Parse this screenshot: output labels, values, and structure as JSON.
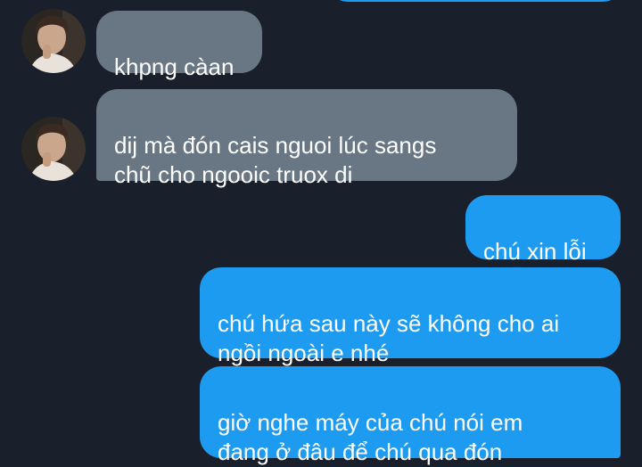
{
  "messages": [
    {
      "sender": "them",
      "text": "khpng càan"
    },
    {
      "sender": "them",
      "text": "dij mà đón cais nguoi lúc sangs\nchũ cho ngooic truox di"
    },
    {
      "sender": "me",
      "text": "chú xin lỗi"
    },
    {
      "sender": "me",
      "text": "chú hứa sau này sẽ không cho ai\nngồi ngoài e nhé"
    },
    {
      "sender": "me",
      "text": "giờ nghe máy của chú nói em\nđang ở đâu để chú qua đón"
    }
  ],
  "colors": {
    "background": "#19202b",
    "received_bubble": "#697683",
    "sent_bubble": "#1d9bf0",
    "text": "#ffffff"
  },
  "icons": {
    "avatar": "contact-avatar-photo"
  }
}
